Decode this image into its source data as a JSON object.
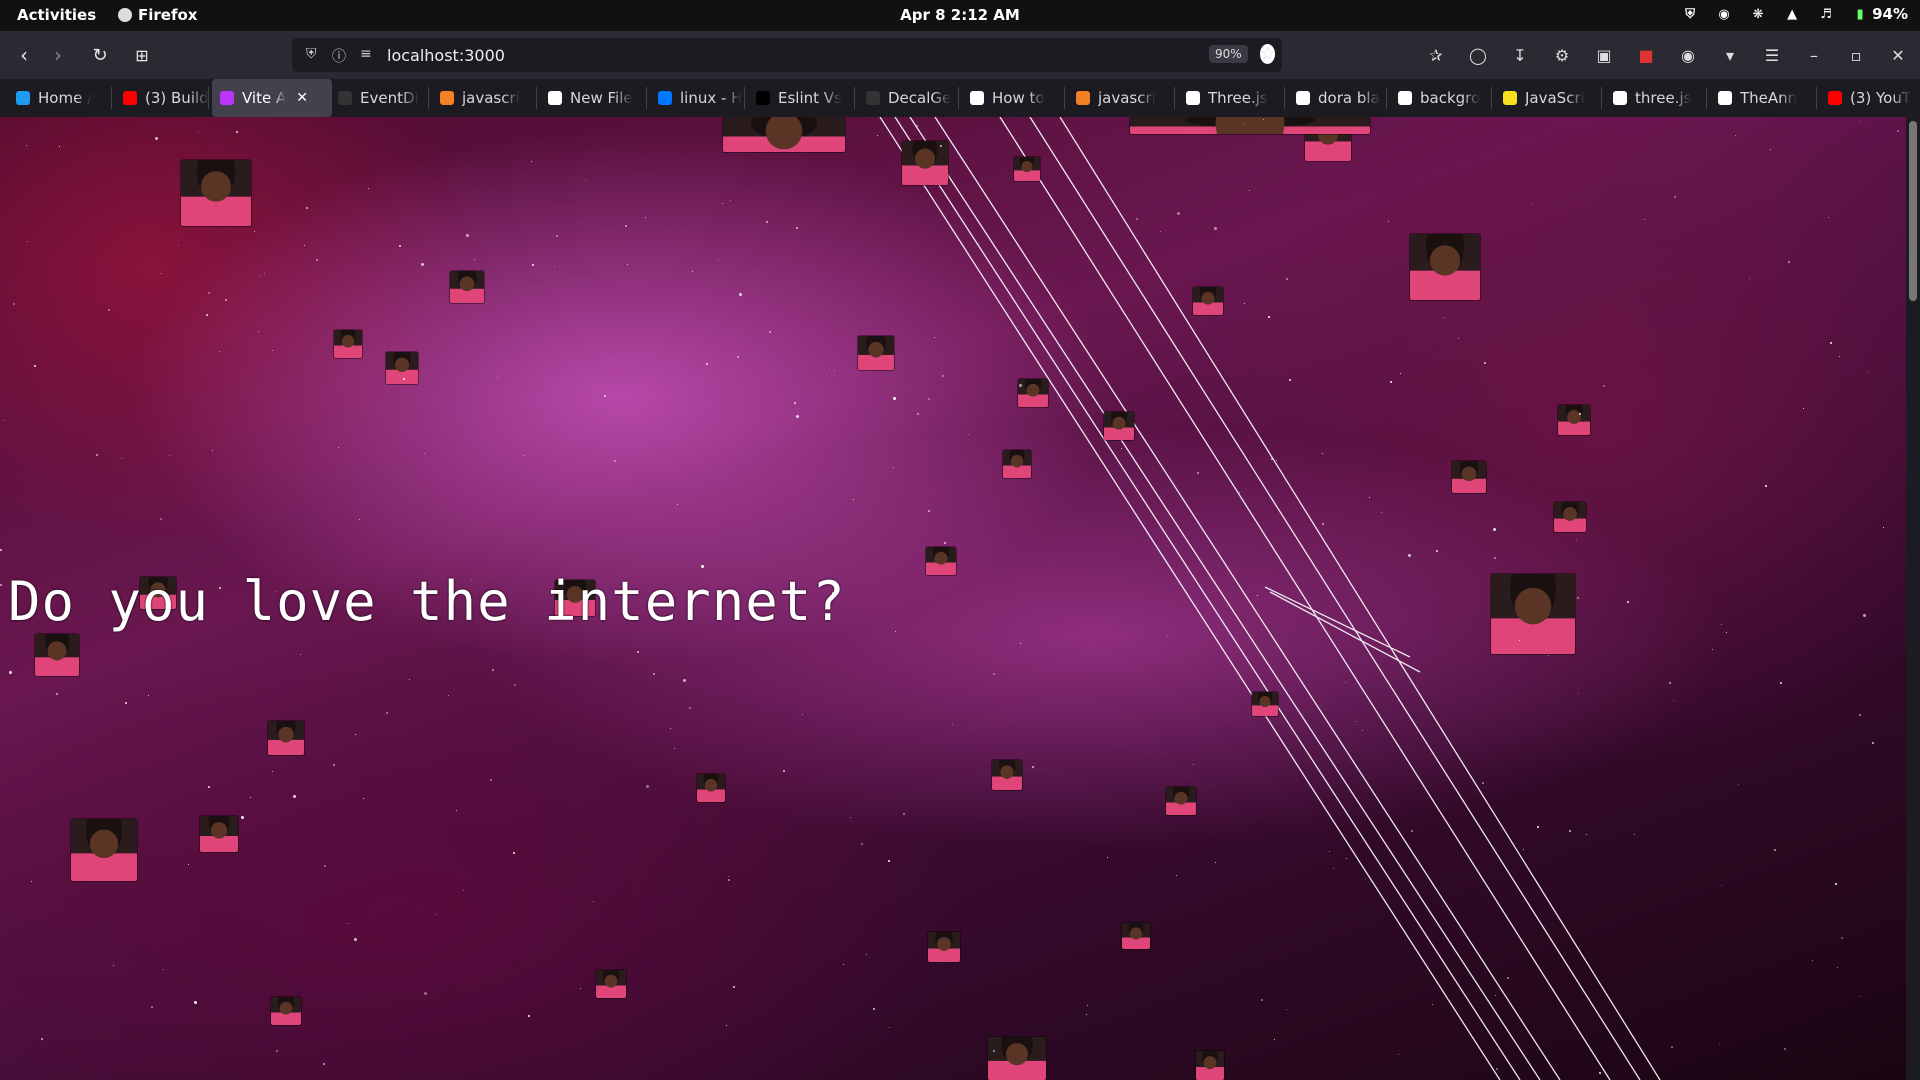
{
  "system_bar": {
    "activities": "Activities",
    "app_name": "Firefox",
    "clock": "Apr 8  2:12 AM",
    "battery": "94%"
  },
  "toolbar": {
    "url": "localhost:3000",
    "zoom": "90%"
  },
  "tabs": [
    {
      "label": "Home /",
      "icon_color": "#1d9bf0"
    },
    {
      "label": "(3) Build",
      "icon_color": "#ff0000"
    },
    {
      "label": "Vite A",
      "icon_color": "#bd34fe",
      "active": true
    },
    {
      "label": "EventDi",
      "icon_color": "#333333"
    },
    {
      "label": "javascri",
      "icon_color": "#f48024"
    },
    {
      "label": "New File",
      "icon_color": "#ffffff"
    },
    {
      "label": "linux - H",
      "icon_color": "#0077ff"
    },
    {
      "label": "Eslint Vs",
      "icon_color": "#000000"
    },
    {
      "label": "DecalGe",
      "icon_color": "#333333"
    },
    {
      "label": "How to",
      "icon_color": "#ffffff"
    },
    {
      "label": "javascri",
      "icon_color": "#f48024"
    },
    {
      "label": "Three.js",
      "icon_color": "#ffffff"
    },
    {
      "label": "dora bla",
      "icon_color": "#ffffff"
    },
    {
      "label": "backgro",
      "icon_color": "#ffffff"
    },
    {
      "label": "JavaScri",
      "icon_color": "#f7df1e"
    },
    {
      "label": "three.js",
      "icon_color": "#ffffff"
    },
    {
      "label": "TheAnn",
      "icon_color": "#ffffff"
    },
    {
      "label": "(3) YouT",
      "icon_color": "#ff0000"
    }
  ],
  "page": {
    "headline": "Do you love the internet?"
  },
  "colors": {
    "toolbar_bg": "#2b2a33",
    "tabstrip_bg": "#1c1b22",
    "active_tab_bg": "#42414d",
    "nebula_accent": "#c04ea8"
  }
}
